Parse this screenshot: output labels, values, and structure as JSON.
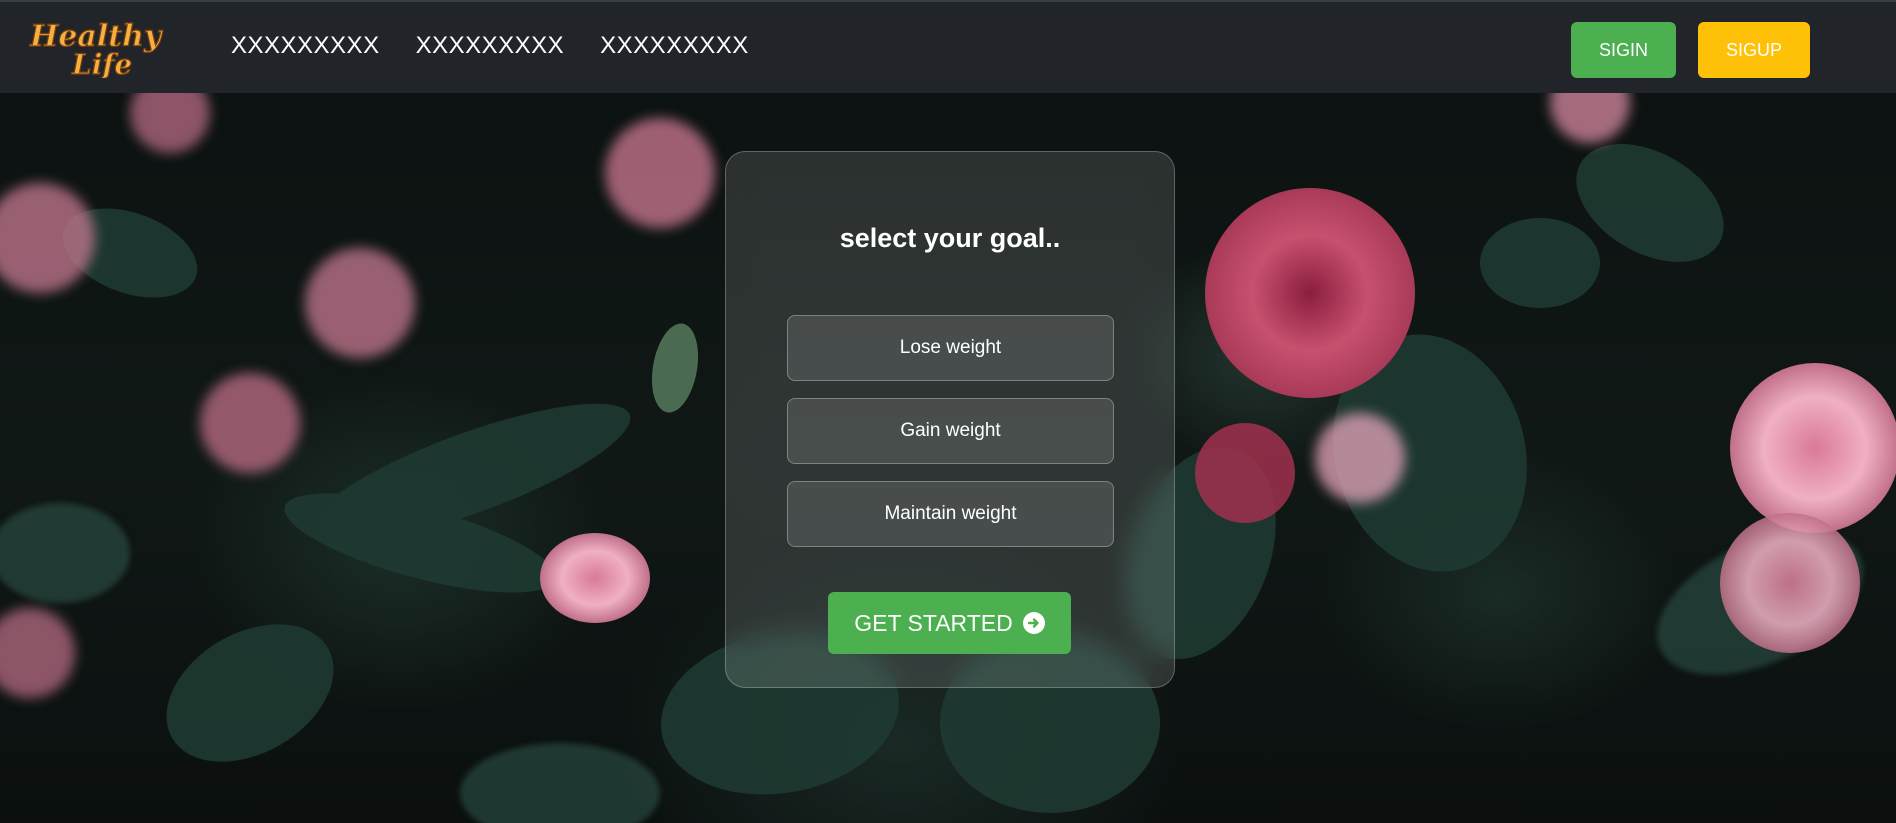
{
  "nav": {
    "brand_line1": "Healthy",
    "brand_line2": "Life",
    "links": [
      "XXXXXXXXX",
      "XXXXXXXXX",
      "XXXXXXXXX"
    ],
    "signin_label": "SIGIN",
    "signup_label": "SIGUP"
  },
  "card": {
    "title": "select your goal..",
    "options": [
      "Lose weight",
      "Gain weight",
      "Maintain weight"
    ],
    "start_label": "GET STARTED",
    "start_icon": "arrow-circle-right-icon"
  },
  "colors": {
    "navbar": "#212529",
    "green": "#4caf50",
    "yellow": "#ffc107",
    "brand_gold": "#f5b041"
  }
}
